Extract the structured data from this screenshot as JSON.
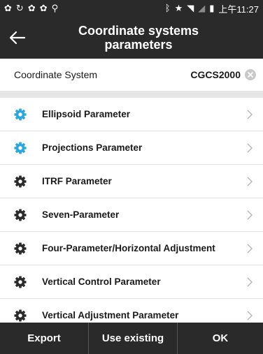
{
  "status_bar": {
    "left_icons": [
      "notification-icon",
      "sync-icon",
      "notification-icon",
      "notification-icon",
      "location-icon"
    ],
    "right_icons": [
      "bluetooth-icon",
      "star-icon",
      "wifi-icon",
      "signal-icon",
      "battery-icon"
    ],
    "time": "上午11:27"
  },
  "header": {
    "title_line1": "Coordinate systems",
    "title_line2": "parameters"
  },
  "coordinate_system": {
    "label": "Coordinate System",
    "value": "CGCS2000"
  },
  "colors": {
    "bar_bg": "#2a2a2a",
    "accent_blue": "#29a7e1",
    "icon_dark": "#2a2a2a"
  },
  "parameters": [
    {
      "label": "Ellipsoid Parameter",
      "icon": "gear-icon",
      "color": "#29a7e1"
    },
    {
      "label": "Projections Parameter",
      "icon": "gear-icon",
      "color": "#29a7e1"
    },
    {
      "label": "ITRF Parameter",
      "icon": "gear-icon",
      "color": "#2a2a2a"
    },
    {
      "label": "Seven-Parameter",
      "icon": "gear-icon",
      "color": "#2a2a2a"
    },
    {
      "label": "Four-Parameter/Horizontal Adjustment",
      "icon": "gear-icon",
      "color": "#2a2a2a"
    },
    {
      "label": "Vertical Control Parameter",
      "icon": "gear-icon",
      "color": "#2a2a2a"
    },
    {
      "label": "Vertical Adjustment Parameter",
      "icon": "gear-icon",
      "color": "#2a2a2a"
    }
  ],
  "footer": {
    "export_label": "Export",
    "use_existing_label": "Use existing",
    "ok_label": "OK"
  }
}
